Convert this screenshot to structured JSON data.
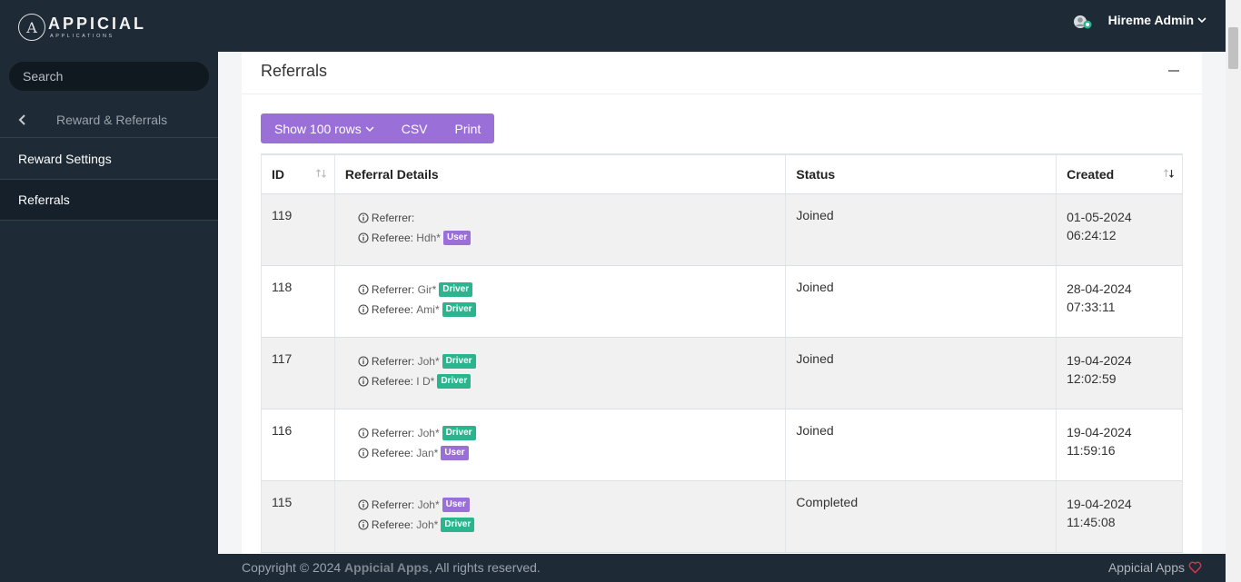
{
  "brand": {
    "logo_letter": "A",
    "name": "APPICIAL",
    "sub": "APPLICATIONS"
  },
  "header": {
    "user_name": "Hireme Admin",
    "avatar_icon": "avatar-icon",
    "chevron_icon": "chevron-down-icon"
  },
  "sidebar": {
    "search_placeholder": "Search",
    "back_label": "Reward & Referrals",
    "items": [
      {
        "label": "Reward Settings",
        "active": false
      },
      {
        "label": "Referrals",
        "active": true
      }
    ]
  },
  "card": {
    "title": "Referrals",
    "toolbar": {
      "rows_label": "Show 100 rows",
      "csv_label": "CSV",
      "print_label": "Print"
    }
  },
  "table": {
    "headers": {
      "id": "ID",
      "details": "Referral Details",
      "status": "Status",
      "created": "Created"
    },
    "rows": [
      {
        "id": "119",
        "referrer_label": "Referrer:",
        "referrer_name": "",
        "referrer_role": "",
        "referee_label": "Referee:",
        "referee_name": "Hdh*",
        "referee_role": "User",
        "status": "Joined",
        "date": "01-05-2024",
        "time": "06:24:12"
      },
      {
        "id": "118",
        "referrer_label": "Referrer:",
        "referrer_name": "Gir*",
        "referrer_role": "Driver",
        "referee_label": "Referee:",
        "referee_name": "Ami*",
        "referee_role": "Driver",
        "status": "Joined",
        "date": "28-04-2024",
        "time": "07:33:11"
      },
      {
        "id": "117",
        "referrer_label": "Referrer:",
        "referrer_name": "Joh*",
        "referrer_role": "Driver",
        "referee_label": "Referee:",
        "referee_name": "I D*",
        "referee_role": "Driver",
        "status": "Joined",
        "date": "19-04-2024",
        "time": "12:02:59"
      },
      {
        "id": "116",
        "referrer_label": "Referrer:",
        "referrer_name": "Joh*",
        "referrer_role": "Driver",
        "referee_label": "Referee:",
        "referee_name": "Jan*",
        "referee_role": "User",
        "status": "Joined",
        "date": "19-04-2024",
        "time": "11:59:16"
      },
      {
        "id": "115",
        "referrer_label": "Referrer:",
        "referrer_name": "Joh*",
        "referrer_role": "User",
        "referee_label": "Referee:",
        "referee_name": "Joh*",
        "referee_role": "Driver",
        "status": "Completed",
        "date": "19-04-2024",
        "time": "11:45:08"
      }
    ]
  },
  "footer": {
    "copyright": "Copyright © 2024",
    "brand": "Appicial Apps",
    "rights": ", All rights reserved.",
    "right_label": "Appicial Apps",
    "heart_color": "#e0344a"
  },
  "colors": {
    "sidebar_bg": "#1e2a35",
    "accent_purple": "#9b6fd8",
    "driver_green": "#2bb58f"
  }
}
